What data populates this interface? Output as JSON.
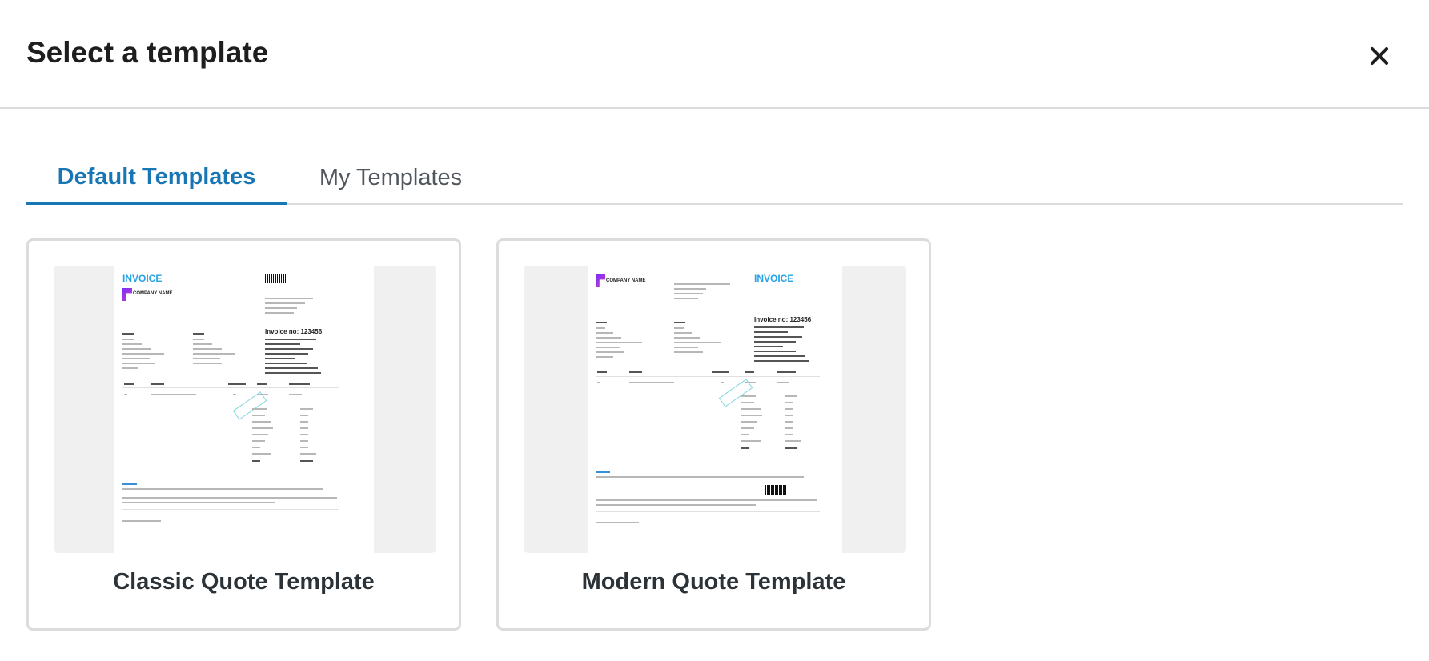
{
  "dialog": {
    "title": "Select a template",
    "close_icon": "close-icon"
  },
  "tabs": [
    {
      "label": "Default Templates",
      "active": true
    },
    {
      "label": "My Templates",
      "active": false
    }
  ],
  "templates": [
    {
      "name": "Classic Quote Template",
      "preview": {
        "heading": "INVOICE",
        "company": "COMPANY NAME",
        "invoice_no": "Invoice no: 123456"
      }
    },
    {
      "name": "Modern Quote Template",
      "preview": {
        "heading": "INVOICE",
        "company": "COMPANY NAME",
        "invoice_no": "Invoice no: 123456"
      }
    }
  ],
  "colors": {
    "accent": "#1976b4",
    "invoice_heading": "#27a3e6",
    "border": "#dcdcde"
  }
}
